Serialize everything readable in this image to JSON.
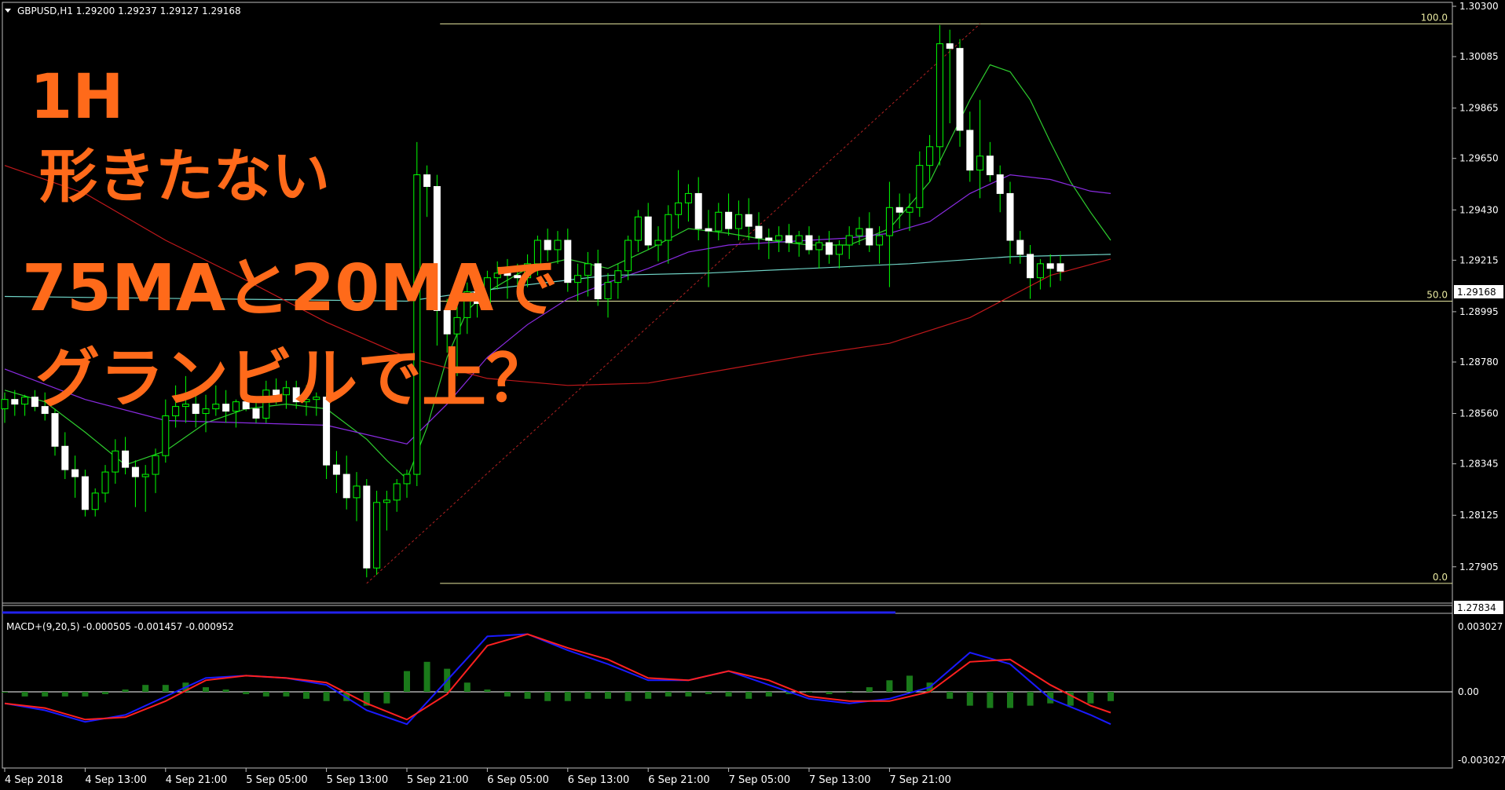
{
  "header": {
    "symbol_info": "GBPUSD,H1  1.29200 1.29237 1.29127 1.29168"
  },
  "colors": {
    "background": "#000000",
    "candle_body": "#ffffff",
    "wick": "#00ff00",
    "ma_fast": "#2ecc2e",
    "ma_mid": "#8a2be2",
    "ma_cyan": "#6fd3c6",
    "ma_red": "#c0181b",
    "fib_line": "#e8e8a0",
    "macd_line": "#1a1aff",
    "signal_line": "#ff2020",
    "histogram": "#1a7a1a",
    "annotation": "#ff6a1a"
  },
  "annotation": {
    "line1": "1H",
    "line2": "形きたない",
    "line3": "75MAと20MAで",
    "line4": "グランビルで上？"
  },
  "price_axis": {
    "current_price_tag": "1.29168",
    "low_price_tag": "1.27834"
  },
  "fibonacci": {
    "levels": [
      {
        "label": "100.0",
        "price": 1.30225
      },
      {
        "label": "50.0",
        "price": 1.2904
      },
      {
        "label": "0.0",
        "price": 1.27834
      }
    ]
  },
  "macd": {
    "label": "MACD+(9,20,5) -0.000505 -0.001457 -0.000952",
    "axis_labels": [
      "0.003027",
      "0.00",
      "-0.003027"
    ]
  },
  "time_axis": {
    "labels": [
      "4 Sep 2018",
      "4 Sep 13:00",
      "4 Sep 21:00",
      "5 Sep 05:00",
      "5 Sep 13:00",
      "5 Sep 21:00",
      "6 Sep 05:00",
      "6 Sep 13:00",
      "6 Sep 21:00",
      "7 Sep 05:00",
      "7 Sep 13:00",
      "7 Sep 21:00"
    ]
  },
  "chart_data": [
    {
      "type": "candlestick",
      "title": "GBPUSD,H1",
      "x": [
        "4 Sep 2018",
        "4 Sep 13:00",
        "4 Sep 21:00",
        "5 Sep 05:00",
        "5 Sep 13:00",
        "5 Sep 21:00",
        "6 Sep 05:00",
        "6 Sep 13:00",
        "6 Sep 21:00",
        "7 Sep 05:00",
        "7 Sep 13:00",
        "7 Sep 21:00"
      ],
      "y_ticks": [
        "1.30300",
        "1.30085",
        "1.29865",
        "1.29650",
        "1.29430",
        "1.29215",
        "1.28995",
        "1.28780",
        "1.28560",
        "1.28345",
        "1.28125",
        "1.27905"
      ],
      "ylim": [
        1.2777,
        1.303
      ],
      "grid": false,
      "ohlc": [
        [
          1.2858,
          1.2865,
          1.2852,
          1.2862
        ],
        [
          1.2862,
          1.2866,
          1.2855,
          1.286
        ],
        [
          1.286,
          1.2864,
          1.2855,
          1.2863
        ],
        [
          1.2863,
          1.2866,
          1.2857,
          1.2859
        ],
        [
          1.2859,
          1.2865,
          1.2853,
          1.2856
        ],
        [
          1.2856,
          1.2858,
          1.2838,
          1.2842
        ],
        [
          1.2842,
          1.2848,
          1.2828,
          1.2832
        ],
        [
          1.2832,
          1.2838,
          1.282,
          1.2829
        ],
        [
          1.2829,
          1.2832,
          1.2812,
          1.2815
        ],
        [
          1.2815,
          1.2824,
          1.2812,
          1.2822
        ],
        [
          1.2822,
          1.2834,
          1.2818,
          1.2831
        ],
        [
          1.2831,
          1.2845,
          1.2826,
          1.284
        ],
        [
          1.284,
          1.2846,
          1.283,
          1.2833
        ],
        [
          1.2833,
          1.2836,
          1.2816,
          1.2829
        ],
        [
          1.2829,
          1.2834,
          1.2814,
          1.283
        ],
        [
          1.283,
          1.2841,
          1.2822,
          1.2838
        ],
        [
          1.2838,
          1.2862,
          1.2835,
          1.2855
        ],
        [
          1.2855,
          1.2868,
          1.285,
          1.2859
        ],
        [
          1.2859,
          1.2872,
          1.2852,
          1.286
        ],
        [
          1.286,
          1.2866,
          1.285,
          1.2856
        ],
        [
          1.2856,
          1.2864,
          1.2848,
          1.2858
        ],
        [
          1.2858,
          1.2868,
          1.2855,
          1.286
        ],
        [
          1.286,
          1.2866,
          1.2852,
          1.2857
        ],
        [
          1.2857,
          1.2862,
          1.285,
          1.2861
        ],
        [
          1.2861,
          1.2869,
          1.2857,
          1.2858
        ],
        [
          1.2858,
          1.2862,
          1.2852,
          1.2854
        ],
        [
          1.2854,
          1.287,
          1.2852,
          1.2866
        ],
        [
          1.2866,
          1.2871,
          1.286,
          1.2864
        ],
        [
          1.2864,
          1.287,
          1.2858,
          1.2867
        ],
        [
          1.2867,
          1.287,
          1.2858,
          1.2861
        ],
        [
          1.2861,
          1.2868,
          1.2855,
          1.2862
        ],
        [
          1.2862,
          1.2865,
          1.2855,
          1.2863
        ],
        [
          1.2863,
          1.2865,
          1.2828,
          1.2834
        ],
        [
          1.2834,
          1.284,
          1.2822,
          1.283
        ],
        [
          1.283,
          1.2838,
          1.2815,
          1.282
        ],
        [
          1.282,
          1.2831,
          1.281,
          1.2825
        ],
        [
          1.2825,
          1.2828,
          1.2786,
          1.279
        ],
        [
          1.279,
          1.2823,
          1.2787,
          1.2818
        ],
        [
          1.2818,
          1.2823,
          1.2806,
          1.2819
        ],
        [
          1.2819,
          1.2828,
          1.2814,
          1.2826
        ],
        [
          1.2826,
          1.2832,
          1.282,
          1.283
        ],
        [
          1.283,
          1.2972,
          1.2825,
          1.2958
        ],
        [
          1.2958,
          1.2962,
          1.294,
          1.2953
        ],
        [
          1.2953,
          1.2958,
          1.2885,
          1.29
        ],
        [
          1.29,
          1.2905,
          1.2882,
          1.289
        ],
        [
          1.289,
          1.2905,
          1.2872,
          1.2897
        ],
        [
          1.2897,
          1.2912,
          1.289,
          1.2908
        ],
        [
          1.2908,
          1.2915,
          1.2897,
          1.2903
        ],
        [
          1.2903,
          1.2917,
          1.2901,
          1.2914
        ],
        [
          1.2914,
          1.2921,
          1.2909,
          1.2916
        ],
        [
          1.2916,
          1.2922,
          1.2905,
          1.2915
        ],
        [
          1.2915,
          1.292,
          1.2907,
          1.2914
        ],
        [
          1.2914,
          1.2924,
          1.291,
          1.292
        ],
        [
          1.292,
          1.2932,
          1.2915,
          1.293
        ],
        [
          1.293,
          1.2935,
          1.2921,
          1.2926
        ],
        [
          1.2926,
          1.2934,
          1.292,
          1.293
        ],
        [
          1.293,
          1.2935,
          1.2908,
          1.2912
        ],
        [
          1.2912,
          1.292,
          1.2904,
          1.2915
        ],
        [
          1.2915,
          1.2925,
          1.2906,
          1.292
        ],
        [
          1.292,
          1.2926,
          1.2902,
          1.2905
        ],
        [
          1.2905,
          1.2916,
          1.2897,
          1.2912
        ],
        [
          1.2912,
          1.292,
          1.2905,
          1.2917
        ],
        [
          1.2917,
          1.2932,
          1.2913,
          1.293
        ],
        [
          1.293,
          1.2943,
          1.2925,
          1.294
        ],
        [
          1.294,
          1.2946,
          1.2926,
          1.2928
        ],
        [
          1.2928,
          1.2936,
          1.2921,
          1.293
        ],
        [
          1.293,
          1.2945,
          1.292,
          1.2941
        ],
        [
          1.2941,
          1.296,
          1.2935,
          1.2946
        ],
        [
          1.2946,
          1.2954,
          1.2938,
          1.295
        ],
        [
          1.295,
          1.2957,
          1.293,
          1.2935
        ],
        [
          1.2935,
          1.2943,
          1.291,
          1.2934
        ],
        [
          1.2934,
          1.2946,
          1.293,
          1.2942
        ],
        [
          1.2942,
          1.295,
          1.2932,
          1.2935
        ],
        [
          1.2935,
          1.2947,
          1.293,
          1.2941
        ],
        [
          1.2941,
          1.2948,
          1.293,
          1.2936
        ],
        [
          1.2936,
          1.2942,
          1.2926,
          1.2931
        ],
        [
          1.2931,
          1.2935,
          1.2922,
          1.293
        ],
        [
          1.293,
          1.2936,
          1.2925,
          1.2932
        ],
        [
          1.2932,
          1.2937,
          1.2925,
          1.2929
        ],
        [
          1.2929,
          1.2934,
          1.2923,
          1.2932
        ],
        [
          1.2932,
          1.2936,
          1.2924,
          1.2926
        ],
        [
          1.2926,
          1.2932,
          1.2918,
          1.2929
        ],
        [
          1.2929,
          1.2934,
          1.292,
          1.2924
        ],
        [
          1.2924,
          1.293,
          1.2918,
          1.2928
        ],
        [
          1.2928,
          1.2936,
          1.2922,
          1.2932
        ],
        [
          1.2932,
          1.294,
          1.2928,
          1.2935
        ],
        [
          1.2935,
          1.2942,
          1.2925,
          1.2928
        ],
        [
          1.2928,
          1.2936,
          1.292,
          1.2932
        ],
        [
          1.2932,
          1.2955,
          1.291,
          1.2944
        ],
        [
          1.2944,
          1.295,
          1.2935,
          1.2942
        ],
        [
          1.2942,
          1.295,
          1.2934,
          1.2944
        ],
        [
          1.2944,
          1.2968,
          1.294,
          1.2962
        ],
        [
          1.2962,
          1.2975,
          1.2955,
          1.297
        ],
        [
          1.297,
          1.3022,
          1.2962,
          1.3014
        ],
        [
          1.3014,
          1.302,
          1.298,
          1.3012
        ],
        [
          1.3012,
          1.3016,
          1.297,
          1.2977
        ],
        [
          1.2977,
          1.2985,
          1.2955,
          1.296
        ],
        [
          1.296,
          1.299,
          1.2948,
          1.2966
        ],
        [
          1.2966,
          1.2972,
          1.2955,
          1.2958
        ],
        [
          1.2958,
          1.2962,
          1.2942,
          1.295
        ],
        [
          1.295,
          1.2955,
          1.292,
          1.293
        ],
        [
          1.293,
          1.2934,
          1.292,
          1.2924
        ],
        [
          1.2924,
          1.2928,
          1.2905,
          1.2914
        ],
        [
          1.2914,
          1.2922,
          1.2909,
          1.292
        ],
        [
          1.292,
          1.2924,
          1.291,
          1.2918
        ],
        [
          1.292,
          1.29237,
          1.29127,
          1.29168
        ]
      ],
      "series": [
        {
          "name": "",
          "color": "#2ecc2e",
          "x_index": [
            0,
            4,
            8,
            12,
            16,
            20,
            24,
            28,
            32,
            36,
            38,
            40,
            42,
            44,
            46,
            48,
            52,
            56,
            60,
            64,
            68,
            72,
            76,
            80,
            84,
            88,
            92,
            96,
            98,
            100,
            102,
            104,
            106,
            108,
            110
          ],
          "values": [
            1.2866,
            1.2861,
            1.2848,
            1.2834,
            1.284,
            1.2852,
            1.2858,
            1.286,
            1.2858,
            1.2845,
            1.2836,
            1.2828,
            1.285,
            1.288,
            1.29,
            1.2908,
            1.2918,
            1.2922,
            1.2918,
            1.2926,
            1.2935,
            1.2933,
            1.293,
            1.2928,
            1.2928,
            1.2935,
            1.2955,
            1.299,
            1.3005,
            1.3002,
            1.299,
            1.2972,
            1.2955,
            1.2942,
            1.293
          ]
        },
        {
          "name": "",
          "color": "#8a2be2",
          "x_index": [
            0,
            8,
            16,
            24,
            32,
            40,
            44,
            48,
            52,
            56,
            60,
            64,
            68,
            72,
            76,
            80,
            84,
            88,
            92,
            96,
            100,
            104,
            108,
            110
          ],
          "values": [
            1.2875,
            1.2862,
            1.2853,
            1.2852,
            1.2851,
            1.2843,
            1.286,
            1.288,
            1.2894,
            1.2905,
            1.2912,
            1.2918,
            1.2925,
            1.2928,
            1.2929,
            1.293,
            1.2931,
            1.2933,
            1.2938,
            1.295,
            1.2958,
            1.2956,
            1.2951,
            1.295
          ]
        },
        {
          "name": "",
          "color": "#6fd3c6",
          "x_index": [
            0,
            20,
            40,
            50,
            60,
            70,
            80,
            90,
            100,
            110
          ],
          "values": [
            1.2906,
            1.2905,
            1.2904,
            1.291,
            1.2915,
            1.2916,
            1.2918,
            1.292,
            1.2923,
            1.2924
          ]
        },
        {
          "name": "",
          "color": "#c0181b",
          "x_index": [
            0,
            8,
            16,
            24,
            32,
            40,
            48,
            56,
            64,
            72,
            80,
            88,
            96,
            104,
            110
          ],
          "values": [
            1.2962,
            1.295,
            1.293,
            1.2913,
            1.2895,
            1.288,
            1.2871,
            1.2868,
            1.2869,
            1.2875,
            1.2881,
            1.2886,
            1.2897,
            1.2915,
            1.2922
          ]
        }
      ]
    },
    {
      "type": "line",
      "title": "MACD+(9,20,5)",
      "ylim": [
        -0.003027,
        0.003027
      ],
      "x_index": [
        0,
        4,
        8,
        12,
        16,
        20,
        24,
        28,
        32,
        36,
        40,
        44,
        48,
        52,
        56,
        60,
        64,
        68,
        72,
        76,
        80,
        84,
        88,
        92,
        96,
        100,
        104,
        108,
        110
      ],
      "series": [
        {
          "name": "",
          "color": "#1a1aff",
          "values": [
            -0.0005,
            -0.0008,
            -0.0013,
            -0.001,
            -0.0002,
            0.0006,
            0.0007,
            0.0006,
            0.0003,
            -0.0008,
            -0.0014,
            0.0005,
            0.0024,
            0.0025,
            0.0018,
            0.0012,
            0.0005,
            0.0005,
            0.0009,
            0.0003,
            -0.0003,
            -0.0005,
            -0.0003,
            0.0002,
            0.0017,
            0.0012,
            -0.0003,
            -0.001,
            -0.0014
          ]
        },
        {
          "name": "",
          "color": "#ff2020",
          "values": [
            -0.0005,
            -0.0007,
            -0.0012,
            -0.0011,
            -0.0004,
            0.0005,
            0.0007,
            0.0006,
            0.0004,
            -0.0005,
            -0.0012,
            -0.0001,
            0.002,
            0.0025,
            0.0019,
            0.0014,
            0.0006,
            0.0005,
            0.0009,
            0.0005,
            -0.0002,
            -0.0004,
            -0.0004,
            0.0,
            0.0013,
            0.0014,
            0.0003,
            -0.0006,
            -0.0009
          ]
        }
      ],
      "histogram_step": 2,
      "histogram": [
        0.0,
        -0.0002,
        -0.0002,
        -0.0002,
        -0.0002,
        -0.0001,
        0.0001,
        0.0003,
        0.0003,
        0.0004,
        0.0002,
        0.0001,
        -0.0001,
        -0.0002,
        -0.0002,
        -0.0003,
        -0.0004,
        -0.0004,
        -0.0006,
        -0.0005,
        0.0009,
        0.0013,
        0.001,
        0.0004,
        0.0001,
        -0.0002,
        -0.0003,
        -0.0004,
        -0.0004,
        -0.0003,
        -0.0003,
        -0.0004,
        -0.0003,
        -0.0002,
        -0.0002,
        -0.0001,
        -0.0002,
        -0.0003,
        -0.0002,
        -0.0001,
        0.0,
        -0.0001,
        0.0,
        0.0002,
        0.0005,
        0.0007,
        0.0004,
        -0.0003,
        -0.0006,
        -0.0007,
        -0.0007,
        -0.0006,
        -0.0005,
        -0.0006,
        -0.0005,
        -0.0004
      ]
    }
  ]
}
